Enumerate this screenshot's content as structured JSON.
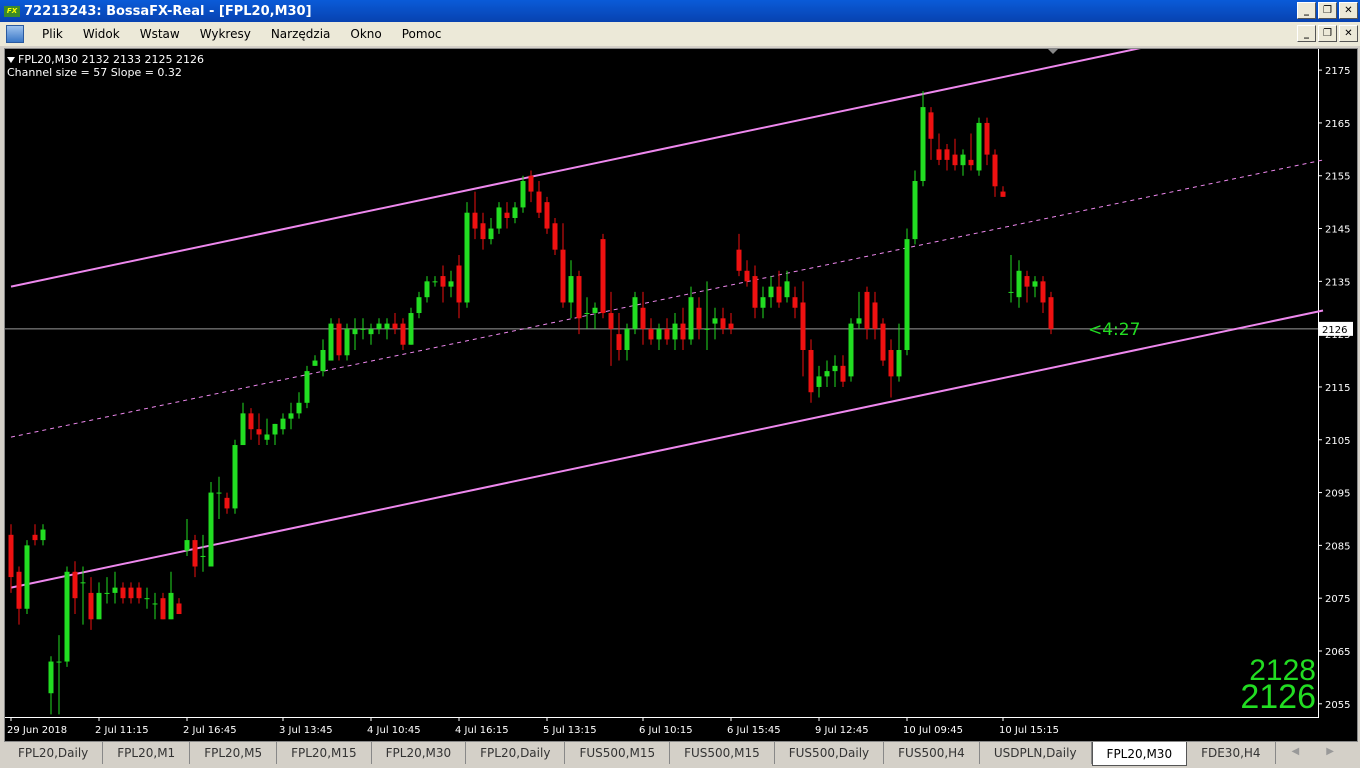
{
  "window": {
    "title": "72213243: BossaFX-Real - [FPL20,M30]",
    "app_icon": "FX"
  },
  "menu": {
    "items": [
      "Plik",
      "Widok",
      "Wstaw",
      "Wykresy",
      "Narzędzia",
      "Okno",
      "Pomoc"
    ]
  },
  "window_buttons": {
    "minimize": "_",
    "restore": "❐",
    "close": "✕"
  },
  "chart": {
    "symbol_line": "FPL20,M30  2132 2133 2125 2126",
    "channel_info": "Channel size = 57 Slope = 0.32",
    "timer": "<4:27",
    "ask_big": "2128",
    "bid_big": "2126",
    "bid_label": "2126",
    "bid_price": 2126,
    "colors": {
      "bull": "#22dd22",
      "bear": "#ee1111",
      "channel": "#ee88ee",
      "grid": "#ffffff"
    },
    "ylim": [
      2052.5,
      2179
    ],
    "price_ticks": [
      "2175",
      "2165",
      "2155",
      "2145",
      "2135",
      "2125",
      "2115",
      "2105",
      "2095",
      "2085",
      "2075",
      "2065",
      "2055"
    ],
    "time_labels": [
      {
        "bar": 0,
        "text": "29 Jun 2018"
      },
      {
        "bar": 11,
        "text": "2 Jul 11:15"
      },
      {
        "bar": 22,
        "text": "2 Jul 16:45"
      },
      {
        "bar": 34,
        "text": "3 Jul 13:45"
      },
      {
        "bar": 45,
        "text": "4 Jul 10:45"
      },
      {
        "bar": 56,
        "text": "4 Jul 16:15"
      },
      {
        "bar": 67,
        "text": "5 Jul 13:15"
      },
      {
        "bar": 79,
        "text": "6 Jul 10:15"
      },
      {
        "bar": 90,
        "text": "6 Jul 15:45"
      },
      {
        "bar": 101,
        "text": "9 Jul 12:45"
      },
      {
        "bar": 112,
        "text": "10 Jul 09:45"
      },
      {
        "bar": 124,
        "text": "10 Jul 15:15"
      }
    ],
    "channel": {
      "lower_start": 2077,
      "slope": 0.32,
      "size": 57,
      "bars": 164
    },
    "candles": [
      [
        2087,
        2089,
        2076,
        2079
      ],
      [
        2080,
        2081,
        2070,
        2073
      ],
      [
        2073,
        2086,
        2072,
        2085
      ],
      [
        2087,
        2089,
        2085,
        2086
      ],
      [
        2086,
        2089,
        2085,
        2088
      ],
      [
        2057,
        2064,
        2053,
        2063
      ],
      [
        2063,
        2068,
        2053,
        2063
      ],
      [
        2063,
        2081,
        2062,
        2080
      ],
      [
        2080,
        2082,
        2072,
        2075
      ],
      [
        2078,
        2081,
        2070,
        2078
      ],
      [
        2076,
        2079,
        2069,
        2071
      ],
      [
        2071,
        2078,
        2071,
        2076
      ],
      [
        2076,
        2079,
        2074,
        2076
      ],
      [
        2076,
        2080,
        2074,
        2077
      ],
      [
        2077,
        2078,
        2074,
        2075
      ],
      [
        2077,
        2078,
        2074,
        2075
      ],
      [
        2077,
        2078,
        2074,
        2075
      ],
      [
        2075,
        2077,
        2073,
        2075
      ],
      [
        2074,
        2076,
        2071,
        2074
      ],
      [
        2075,
        2076,
        2071,
        2071
      ],
      [
        2071,
        2080,
        2071,
        2076
      ],
      [
        2074,
        2075,
        2072,
        2072
      ],
      [
        2084,
        2090,
        2083,
        2086
      ],
      [
        2086,
        2087,
        2079,
        2081
      ],
      [
        2083,
        2087,
        2080,
        2083
      ],
      [
        2081,
        2097,
        2081,
        2095
      ],
      [
        2095,
        2098,
        2090,
        2095
      ],
      [
        2094,
        2095,
        2091,
        2092
      ],
      [
        2092,
        2105,
        2091,
        2104
      ],
      [
        2104,
        2112,
        2104,
        2110
      ],
      [
        2110,
        2111,
        2105,
        2107
      ],
      [
        2107,
        2110,
        2104,
        2106
      ],
      [
        2105,
        2109,
        2104,
        2106
      ],
      [
        2106,
        2108,
        2104,
        2108
      ],
      [
        2107,
        2110,
        2106,
        2109
      ],
      [
        2109,
        2112,
        2107,
        2110
      ],
      [
        2110,
        2114,
        2109,
        2112
      ],
      [
        2112,
        2119,
        2111,
        2118
      ],
      [
        2119,
        2121,
        2119,
        2120
      ],
      [
        2118,
        2124,
        2117,
        2122
      ],
      [
        2120,
        2128,
        2120,
        2127
      ],
      [
        2127,
        2128,
        2120,
        2121
      ],
      [
        2121,
        2127,
        2120,
        2126
      ],
      [
        2125,
        2128,
        2122,
        2126
      ],
      [
        2126,
        2128,
        2124,
        2126
      ],
      [
        2125,
        2127,
        2123,
        2126
      ],
      [
        2126,
        2128,
        2125,
        2127
      ],
      [
        2126,
        2128,
        2124,
        2127
      ],
      [
        2127,
        2129,
        2125,
        2126
      ],
      [
        2127,
        2128,
        2122,
        2123
      ],
      [
        2123,
        2130,
        2123,
        2129
      ],
      [
        2129,
        2133,
        2128,
        2132
      ],
      [
        2132,
        2136,
        2131,
        2135
      ],
      [
        2135,
        2136,
        2134,
        2135
      ],
      [
        2136,
        2138,
        2131,
        2134
      ],
      [
        2134,
        2137,
        2132,
        2135
      ],
      [
        2138,
        2140,
        2128,
        2131
      ],
      [
        2131,
        2150,
        2130,
        2148
      ],
      [
        2148,
        2152,
        2143,
        2145
      ],
      [
        2146,
        2148,
        2141,
        2143
      ],
      [
        2143,
        2147,
        2142,
        2145
      ],
      [
        2145,
        2150,
        2144,
        2149
      ],
      [
        2148,
        2150,
        2145,
        2147
      ],
      [
        2147,
        2150,
        2146,
        2149
      ],
      [
        2149,
        2155,
        2148,
        2154
      ],
      [
        2155,
        2156,
        2150,
        2152
      ],
      [
        2152,
        2154,
        2147,
        2148
      ],
      [
        2150,
        2151,
        2144,
        2145
      ],
      [
        2146,
        2147,
        2140,
        2141
      ],
      [
        2141,
        2146,
        2130,
        2131
      ],
      [
        2131,
        2139,
        2128,
        2136
      ],
      [
        2136,
        2137,
        2125,
        2128
      ],
      [
        2129,
        2132,
        2126,
        2129
      ],
      [
        2129,
        2131,
        2126,
        2130
      ],
      [
        2143,
        2144,
        2128,
        2129
      ],
      [
        2129,
        2133,
        2119,
        2126
      ],
      [
        2125,
        2129,
        2120,
        2122
      ],
      [
        2122,
        2127,
        2120,
        2126
      ],
      [
        2126,
        2133,
        2125,
        2132
      ],
      [
        2130,
        2133,
        2123,
        2126
      ],
      [
        2126,
        2128,
        2123,
        2124
      ],
      [
        2124,
        2127,
        2122,
        2126
      ],
      [
        2126,
        2128,
        2123,
        2124
      ],
      [
        2124,
        2129,
        2122,
        2127
      ],
      [
        2127,
        2130,
        2122,
        2124
      ],
      [
        2124,
        2134,
        2123,
        2132
      ],
      [
        2130,
        2132,
        2124,
        2126
      ],
      [
        2126,
        2135,
        2122,
        2126
      ],
      [
        2127,
        2130,
        2124,
        2128
      ],
      [
        2128,
        2130,
        2125,
        2126
      ],
      [
        2127,
        2129,
        2125,
        2126
      ],
      [
        2141,
        2144,
        2136,
        2137
      ],
      [
        2137,
        2139,
        2134,
        2135
      ],
      [
        2136,
        2138,
        2128,
        2130
      ],
      [
        2130,
        2134,
        2128,
        2132
      ],
      [
        2132,
        2136,
        2130,
        2134
      ],
      [
        2134,
        2137,
        2130,
        2131
      ],
      [
        2132,
        2137,
        2131,
        2135
      ],
      [
        2132,
        2134,
        2128,
        2130
      ],
      [
        2131,
        2135,
        2117,
        2122
      ],
      [
        2122,
        2124,
        2112,
        2114
      ],
      [
        2115,
        2119,
        2113,
        2117
      ],
      [
        2117,
        2120,
        2115,
        2118
      ],
      [
        2118,
        2121,
        2115,
        2119
      ],
      [
        2119,
        2121,
        2115,
        2116
      ],
      [
        2117,
        2128,
        2116,
        2127
      ],
      [
        2127,
        2133,
        2126,
        2128
      ],
      [
        2133,
        2134,
        2124,
        2126
      ],
      [
        2131,
        2133,
        2124,
        2126
      ],
      [
        2127,
        2128,
        2119,
        2120
      ],
      [
        2122,
        2124,
        2113,
        2117
      ],
      [
        2117,
        2127,
        2116,
        2122
      ],
      [
        2122,
        2145,
        2121,
        2143
      ],
      [
        2143,
        2156,
        2142,
        2154
      ],
      [
        2154,
        2171,
        2153,
        2168
      ],
      [
        2167,
        2168,
        2158,
        2162
      ],
      [
        2160,
        2163,
        2157,
        2158
      ],
      [
        2160,
        2161,
        2156,
        2158
      ],
      [
        2159,
        2162,
        2156,
        2157
      ],
      [
        2157,
        2160,
        2155,
        2159
      ],
      [
        2158,
        2163,
        2156,
        2157
      ],
      [
        2156,
        2166,
        2155,
        2165
      ],
      [
        2165,
        2166,
        2157,
        2159
      ],
      [
        2159,
        2160,
        2151,
        2153
      ],
      [
        2152,
        2153,
        2151,
        2151
      ],
      [
        2133,
        2140,
        2131,
        2133
      ],
      [
        2132,
        2139,
        2130,
        2137
      ],
      [
        2136,
        2137,
        2131,
        2134
      ],
      [
        2134,
        2136,
        2132,
        2135
      ],
      [
        2135,
        2136,
        2129,
        2131
      ],
      [
        2132,
        2133,
        2125,
        2126
      ]
    ]
  },
  "tabs": {
    "items": [
      "FPL20,Daily",
      "FPL20,M1",
      "FPL20,M5",
      "FPL20,M15",
      "FPL20,M30",
      "FPL20,Daily",
      "FUS500,M15",
      "FUS500,M15",
      "FUS500,Daily",
      "FUS500,H4",
      "USDPLN,Daily",
      "FPL20,M30",
      "FDE30,H4"
    ],
    "active": 11,
    "scroll": "◀ ▶"
  }
}
